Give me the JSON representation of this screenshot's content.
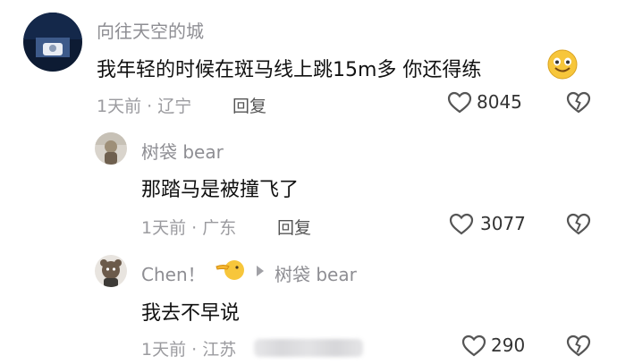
{
  "comments": [
    {
      "username": "向往天空的城",
      "text": "我年轻的时候在斑马线上跳15m多  你还得练",
      "time_location": "1天前 · 辽宁",
      "reply_label": "回复",
      "likes": "8045"
    },
    {
      "username": "树袋 bear",
      "text": "那踏马是被撞飞了",
      "time_location": "1天前 · 广东",
      "reply_label": "回复",
      "likes": "3077"
    },
    {
      "username": "Chen！",
      "reply_to": "树袋 bear",
      "text": "我去不早说",
      "time_location": "1天前 · 江苏",
      "likes": "290"
    }
  ],
  "icons": {
    "like": "heart-outline-icon",
    "dislike": "broken-heart-icon",
    "reply_arrow": "triangle-right-icon"
  }
}
